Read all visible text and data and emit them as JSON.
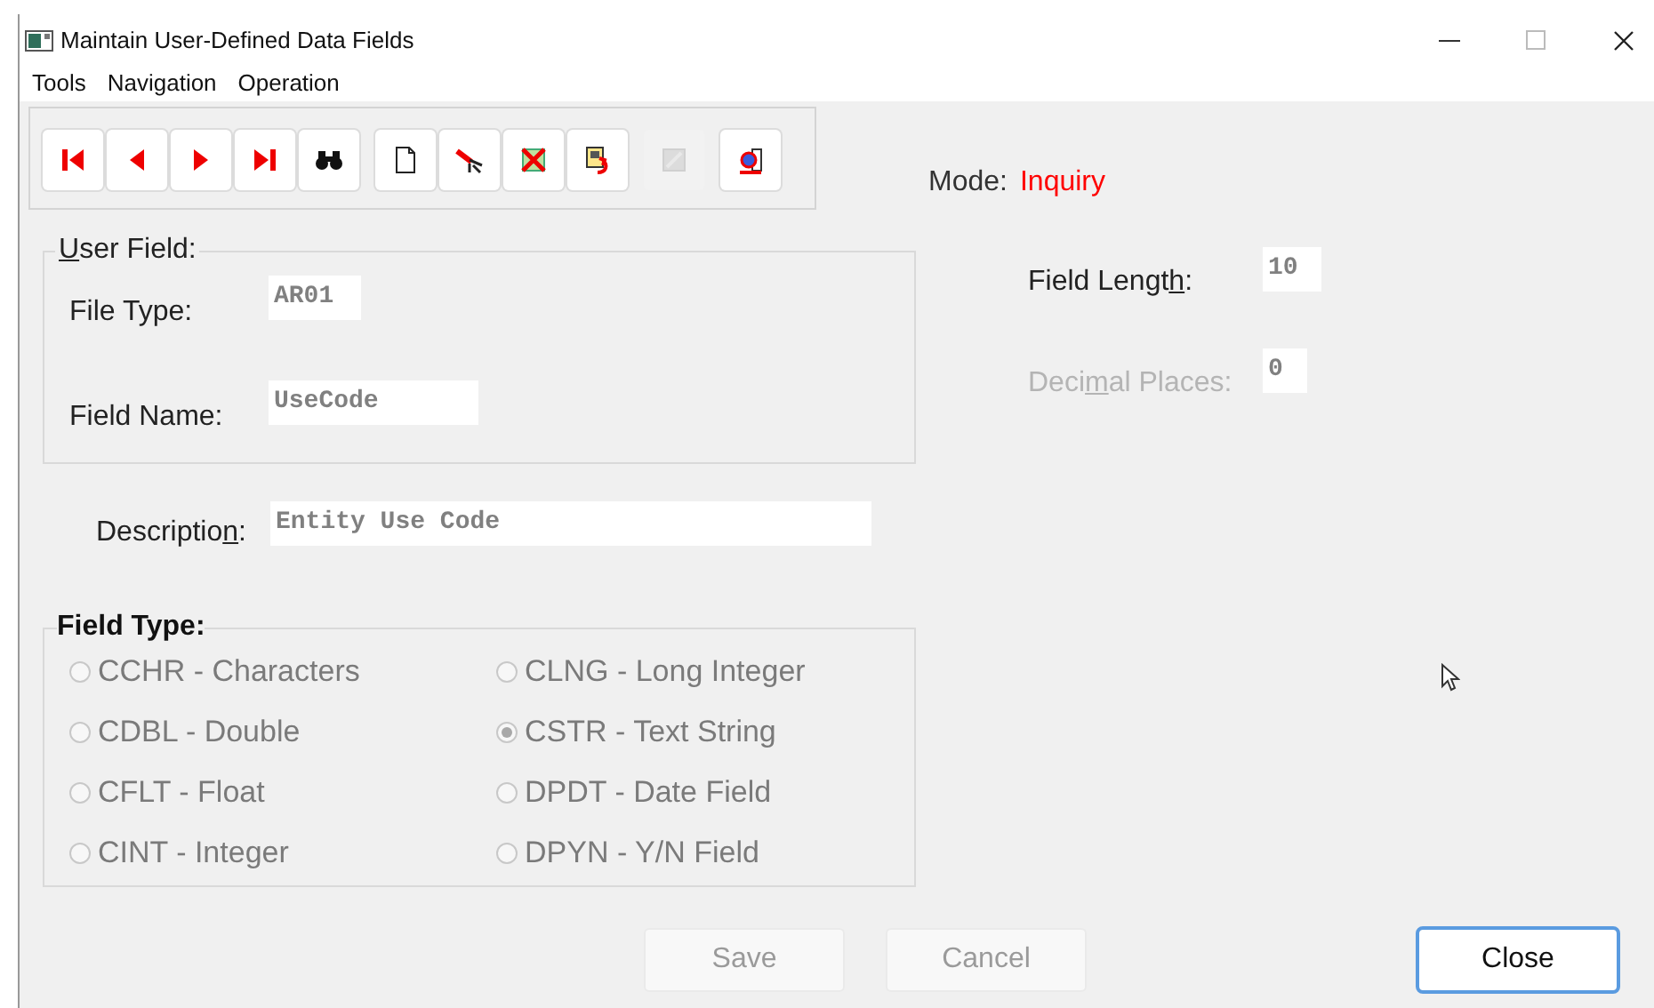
{
  "window": {
    "title": "Maintain User-Defined Data Fields"
  },
  "menu": [
    "Tools",
    "Navigation",
    "Operation"
  ],
  "toolbar": [
    {
      "disabled": false
    },
    {
      "disabled": false
    },
    {
      "disabled": false
    },
    {
      "disabled": false
    },
    {
      "disabled": false
    },
    {
      "disabled": false
    },
    {
      "disabled": false
    },
    {
      "disabled": false
    },
    {
      "disabled": false
    },
    {
      "disabled": true
    },
    {
      "disabled": false
    }
  ],
  "mode": {
    "label": "Mode:",
    "value": "Inquiry"
  },
  "user_field": {
    "legend": {
      "mnemonic": "U",
      "end": "ser Field:"
    },
    "file_type": {
      "label": "File Type:",
      "value": "AR01"
    },
    "field_name": {
      "label": "Field Name:",
      "value": "UseCode"
    }
  },
  "description": {
    "label": {
      "start": "Descriptio",
      "mnemonic": "n",
      "end": ":"
    },
    "value": "Entity Use Code"
  },
  "field_length": {
    "label": {
      "start": "Field Lengt",
      "mnemonic": "h",
      "end": ":"
    },
    "value": "10",
    "disabled": false
  },
  "decimal_places": {
    "label": {
      "start": "Deci",
      "mnemonic": "m",
      "end": "al Places:"
    },
    "value": "0",
    "disabled": true
  },
  "field_type": {
    "legend": "Field Type:",
    "disabled": true,
    "options": [
      {
        "label": "CCHR - Characters",
        "selected": false
      },
      {
        "label": "CLNG - Long Integer",
        "selected": false
      },
      {
        "label": "CDBL - Double",
        "selected": false
      },
      {
        "label": "CSTR - Text String",
        "selected": true
      },
      {
        "label": "CFLT - Float",
        "selected": false
      },
      {
        "label": "DPDT - Date Field",
        "selected": false
      },
      {
        "label": "CINT - Integer",
        "selected": false
      },
      {
        "label": "DPYN - Y/N Field",
        "selected": false
      }
    ]
  },
  "buttons": [
    {
      "label": "Save",
      "disabled": true,
      "default": false
    },
    {
      "label": "Cancel",
      "disabled": true,
      "default": false
    },
    {
      "label": "Close",
      "disabled": false,
      "default": true
    }
  ]
}
